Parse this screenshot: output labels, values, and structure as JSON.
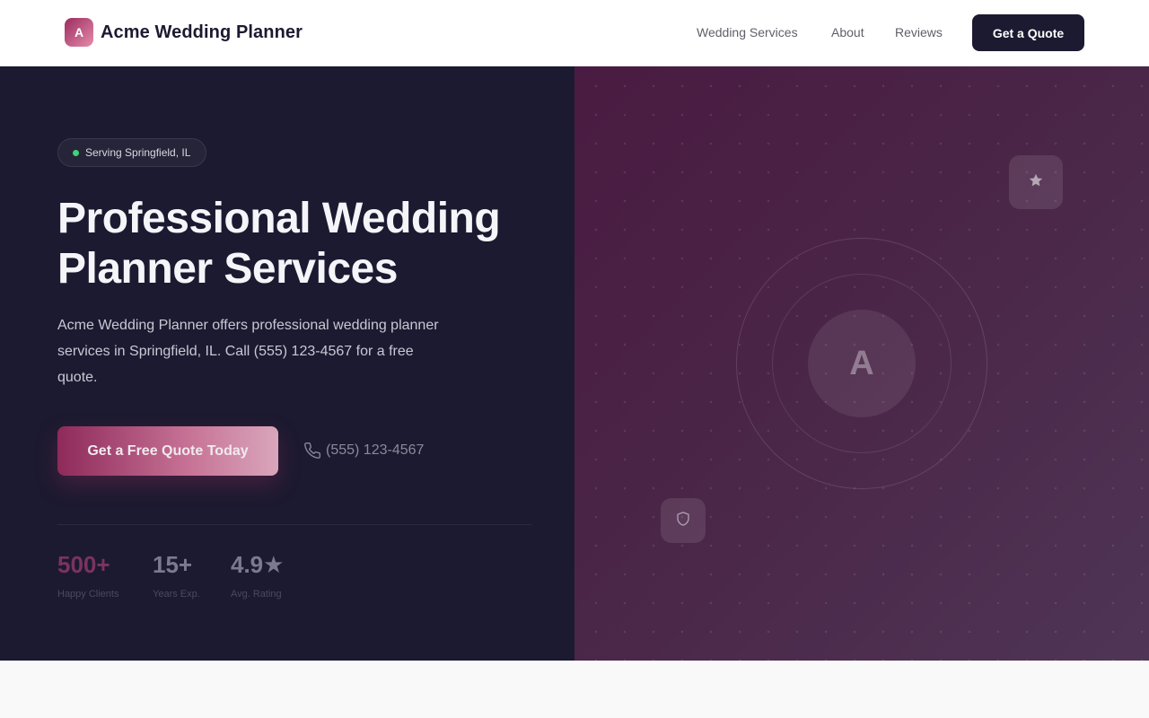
{
  "header": {
    "logo_letter": "A",
    "brand_name": "Acme Wedding Planner",
    "nav": {
      "services": "Wedding Services",
      "about": "About",
      "reviews": "Reviews"
    },
    "quote_button": "Get a Quote"
  },
  "hero": {
    "location_badge": "Serving Springfield, IL",
    "title": "Professional Wedding Planner Services",
    "description": "Acme Wedding Planner offers professional wedding planner services in Springfield, IL. Call (555) 123-4567 for a free quote.",
    "cta_button": "Get a Free Quote Today",
    "phone": "(555) 123-4567",
    "stats": [
      {
        "value": "500+",
        "label": "Happy Clients"
      },
      {
        "value": "15+",
        "label": "Years Exp."
      },
      {
        "value": "4.9★",
        "label": "Avg. Rating"
      }
    ]
  },
  "visual": {
    "center_letter": "A",
    "icons": [
      "star-icon",
      "shield-icon",
      "phone-icon"
    ]
  },
  "colors": {
    "brand_dark": "#1c1a30",
    "accent": "#9b2b5f",
    "status_dot": "#3fd27a"
  }
}
